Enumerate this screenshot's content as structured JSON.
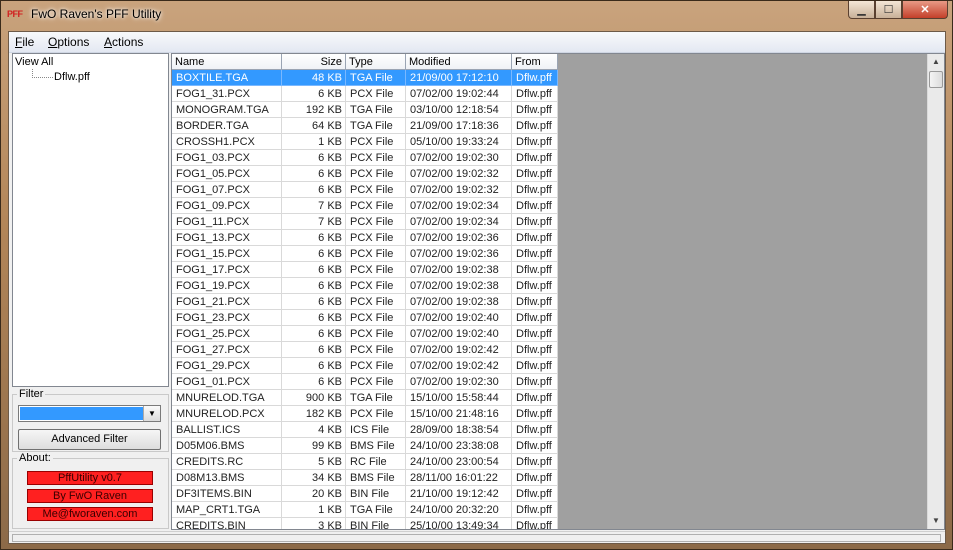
{
  "window": {
    "icon_text": "PFF",
    "title": "FwO Raven's PFF Utility",
    "buttons": {
      "minimize": "▁",
      "maximize": "☐",
      "close": "✕"
    }
  },
  "menu": [
    {
      "key": "F",
      "rest": "ile"
    },
    {
      "key": "O",
      "rest": "ptions"
    },
    {
      "key": "A",
      "rest": "ctions"
    }
  ],
  "tree": {
    "root": "View All",
    "child": "Dflw.pff"
  },
  "filter": {
    "label": "Filter",
    "selected": "",
    "advanced_button": "Advanced Filter"
  },
  "about": {
    "label": "About:",
    "lines": [
      "PffUtility v0.7",
      "By FwO Raven",
      "Me@fworaven.com"
    ]
  },
  "list": {
    "columns": [
      "Name",
      "Size",
      "Type",
      "Modified",
      "From"
    ],
    "selected_index": 0,
    "rows": [
      [
        "BOXTILE.TGA",
        "48 KB",
        "TGA File",
        "21/09/00 17:12:10",
        "Dflw.pff"
      ],
      [
        "FOG1_31.PCX",
        "6 KB",
        "PCX File",
        "07/02/00 19:02:44",
        "Dflw.pff"
      ],
      [
        "MONOGRAM.TGA",
        "192 KB",
        "TGA File",
        "03/10/00 12:18:54",
        "Dflw.pff"
      ],
      [
        "BORDER.TGA",
        "64 KB",
        "TGA File",
        "21/09/00 17:18:36",
        "Dflw.pff"
      ],
      [
        "CROSSH1.PCX",
        "1 KB",
        "PCX File",
        "05/10/00 19:33:24",
        "Dflw.pff"
      ],
      [
        "FOG1_03.PCX",
        "6 KB",
        "PCX File",
        "07/02/00 19:02:30",
        "Dflw.pff"
      ],
      [
        "FOG1_05.PCX",
        "6 KB",
        "PCX File",
        "07/02/00 19:02:32",
        "Dflw.pff"
      ],
      [
        "FOG1_07.PCX",
        "6 KB",
        "PCX File",
        "07/02/00 19:02:32",
        "Dflw.pff"
      ],
      [
        "FOG1_09.PCX",
        "7 KB",
        "PCX File",
        "07/02/00 19:02:34",
        "Dflw.pff"
      ],
      [
        "FOG1_11.PCX",
        "7 KB",
        "PCX File",
        "07/02/00 19:02:34",
        "Dflw.pff"
      ],
      [
        "FOG1_13.PCX",
        "6 KB",
        "PCX File",
        "07/02/00 19:02:36",
        "Dflw.pff"
      ],
      [
        "FOG1_15.PCX",
        "6 KB",
        "PCX File",
        "07/02/00 19:02:36",
        "Dflw.pff"
      ],
      [
        "FOG1_17.PCX",
        "6 KB",
        "PCX File",
        "07/02/00 19:02:38",
        "Dflw.pff"
      ],
      [
        "FOG1_19.PCX",
        "6 KB",
        "PCX File",
        "07/02/00 19:02:38",
        "Dflw.pff"
      ],
      [
        "FOG1_21.PCX",
        "6 KB",
        "PCX File",
        "07/02/00 19:02:38",
        "Dflw.pff"
      ],
      [
        "FOG1_23.PCX",
        "6 KB",
        "PCX File",
        "07/02/00 19:02:40",
        "Dflw.pff"
      ],
      [
        "FOG1_25.PCX",
        "6 KB",
        "PCX File",
        "07/02/00 19:02:40",
        "Dflw.pff"
      ],
      [
        "FOG1_27.PCX",
        "6 KB",
        "PCX File",
        "07/02/00 19:02:42",
        "Dflw.pff"
      ],
      [
        "FOG1_29.PCX",
        "6 KB",
        "PCX File",
        "07/02/00 19:02:42",
        "Dflw.pff"
      ],
      [
        "FOG1_01.PCX",
        "6 KB",
        "PCX File",
        "07/02/00 19:02:30",
        "Dflw.pff"
      ],
      [
        "MNURELOD.TGA",
        "900 KB",
        "TGA File",
        "15/10/00 15:58:44",
        "Dflw.pff"
      ],
      [
        "MNURELOD.PCX",
        "182 KB",
        "PCX File",
        "15/10/00 21:48:16",
        "Dflw.pff"
      ],
      [
        "BALLIST.ICS",
        "4 KB",
        "ICS File",
        "28/09/00 18:38:54",
        "Dflw.pff"
      ],
      [
        "D05M06.BMS",
        "99 KB",
        "BMS File",
        "24/10/00 23:38:08",
        "Dflw.pff"
      ],
      [
        "CREDITS.RC",
        "5 KB",
        "RC File",
        "24/10/00 23:00:54",
        "Dflw.pff"
      ],
      [
        "D08M13.BMS",
        "34 KB",
        "BMS File",
        "28/11/00 16:01:22",
        "Dflw.pff"
      ],
      [
        "DF3ITEMS.BIN",
        "20 KB",
        "BIN File",
        "21/10/00 19:12:42",
        "Dflw.pff"
      ],
      [
        "MAP_CRT1.TGA",
        "1 KB",
        "TGA File",
        "24/10/00 20:32:20",
        "Dflw.pff"
      ],
      [
        "CREDITS.BIN",
        "3 KB",
        "BIN File",
        "25/10/00 13:49:34",
        "Dflw.pff"
      ]
    ]
  },
  "scrollbar": {
    "up": "▲",
    "down": "▼"
  }
}
